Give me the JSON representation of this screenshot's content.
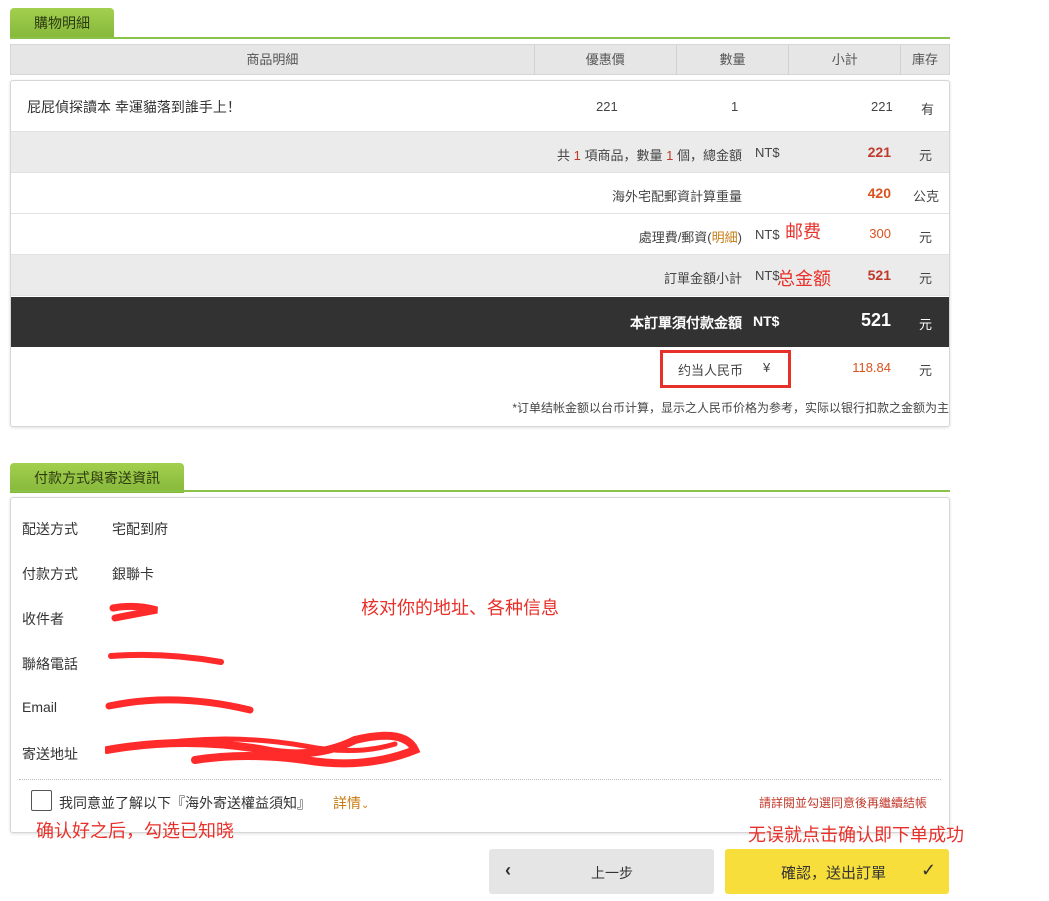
{
  "cart": {
    "tab_label": "購物明細",
    "headers": {
      "product": "商品明細",
      "price": "優惠價",
      "qty": "數量",
      "subtotal": "小計",
      "stock": "庫存"
    },
    "item": {
      "name": "屁屁偵探讀本 幸運貓落到誰手上！",
      "price": "221",
      "qty": "1",
      "subtotal": "221",
      "stock": "有"
    },
    "summary": {
      "count_prefix": "共",
      "count_items": "1",
      "count_mid": "項商品，數量",
      "count_qty": "1",
      "count_suffix": "個，總金額",
      "currency": "NT$",
      "total": "221",
      "unit": "元",
      "weight_label": "海外宅配郵資計算重量",
      "weight_value": "420",
      "weight_unit": "公克",
      "shipping_label": "處理費/郵資(",
      "shipping_detail": "明細",
      "shipping_label_end": ")",
      "shipping_currency": "NT$",
      "shipping_value": "300",
      "shipping_unit": "元",
      "order_sub_label": "訂單金額小計",
      "order_sub_currency": "NT$",
      "order_sub_value": "521",
      "order_sub_unit": "元",
      "pay_label": "本訂單須付款金額",
      "pay_currency": "NT$",
      "pay_value": "521",
      "pay_unit": "元",
      "rmb_label": "约当人民币",
      "rmb_currency": "¥",
      "rmb_value": "118.84",
      "rmb_unit": "元",
      "note": "*订单结帐金额以台币计算，显示之人民币价格为参考，实际以银行扣款之金额为主"
    }
  },
  "info": {
    "tab_label": "付款方式與寄送資訊",
    "rows": [
      {
        "label": "配送方式",
        "value": "宅配到府"
      },
      {
        "label": "付款方式",
        "value": "銀聯卡"
      },
      {
        "label": "收件者",
        "value": ""
      },
      {
        "label": "聯絡電話",
        "value": ""
      },
      {
        "label": "Email",
        "value": ""
      },
      {
        "label": "寄送地址",
        "value": ""
      }
    ],
    "agree_text": "我同意並了解以下『海外寄送權益須知』",
    "agree_detail": "詳情",
    "agree_warn": "請詳閱並勾選同意後再繼續結帳"
  },
  "buttons": {
    "prev": "上一步",
    "confirm": "確認，送出訂單"
  },
  "annotations": {
    "shipping": "邮费",
    "total": "总金额",
    "check_info": "核对你的地址、各种信息",
    "tick": "确认好之后，勾选已知晓",
    "confirm": "无误就点击确认即下单成功"
  },
  "colors": {
    "accent": "#8bc34a",
    "price_red": "#c0392b",
    "annotation_red": "#e8302a",
    "confirm_yellow": "#f7de3a"
  }
}
